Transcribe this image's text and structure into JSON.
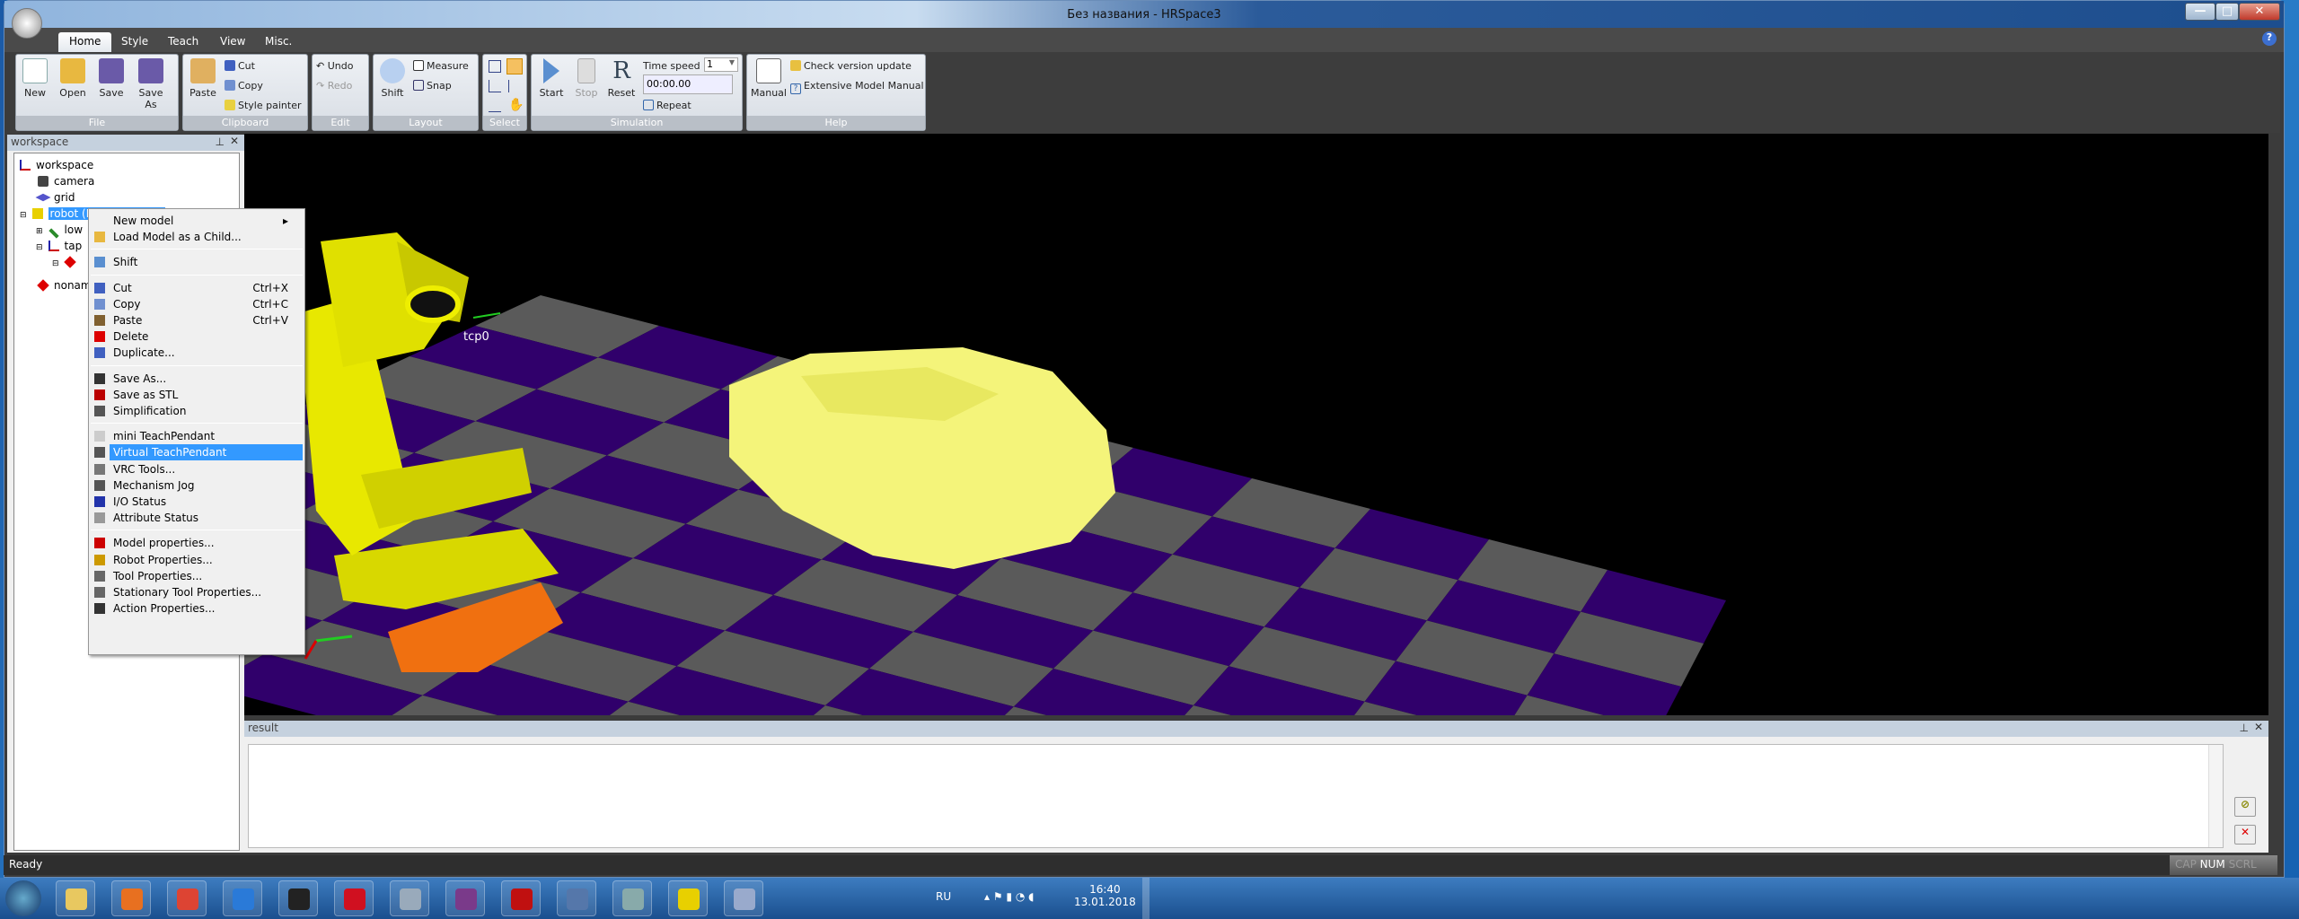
{
  "window": {
    "title": "Без названия - HRSpace3",
    "minimize": "—",
    "maximize": "□",
    "close": "✕"
  },
  "tabs": [
    "Home",
    "Style",
    "Teach",
    "View",
    "Misc."
  ],
  "ribbon": {
    "file": {
      "label": "File",
      "new": "New",
      "open": "Open",
      "save": "Save",
      "save_as": "Save As"
    },
    "clipboard": {
      "label": "Clipboard",
      "paste": "Paste",
      "cut": "Cut",
      "copy": "Copy",
      "style_painter": "Style painter"
    },
    "edit": {
      "label": "Edit",
      "undo": "Undo",
      "redo": "Redo"
    },
    "layout": {
      "label": "Layout",
      "shift": "Shift",
      "measure": "Measure",
      "snap": "Snap"
    },
    "select": {
      "label": "Select"
    },
    "simulation": {
      "label": "Simulation",
      "start": "Start",
      "stop": "Stop",
      "reset": "Reset",
      "time_speed_label": "Time speed",
      "time_speed_value": "1",
      "time": "00:00.00",
      "repeat": "Repeat"
    },
    "help": {
      "label": "Help",
      "manual": "Manual",
      "check_update": "Check version update",
      "model_manual": "Extensive Model Manual"
    }
  },
  "workspace": {
    "title": "workspace",
    "tree": [
      "workspace",
      "camera",
      "grid",
      "robot (MC165-02) [0]",
      "low",
      "tap",
      "",
      "nonam"
    ]
  },
  "viewport": {
    "tcp_label": "tcp0",
    "colors": {
      "floor_dark": "#30006b",
      "floor_light": "#5a5a5a",
      "robot": "#e8e800",
      "base": "#f07010",
      "car": "#f4f47a"
    }
  },
  "context_menu": {
    "items": [
      {
        "label": "New model",
        "submenu": true
      },
      {
        "label": "Load Model as a Child..."
      },
      {
        "label": "Shift"
      },
      {
        "label": "Cut",
        "shortcut": "Ctrl+X"
      },
      {
        "label": "Copy",
        "shortcut": "Ctrl+C"
      },
      {
        "label": "Paste",
        "shortcut": "Ctrl+V"
      },
      {
        "label": "Delete"
      },
      {
        "label": "Duplicate..."
      },
      {
        "label": "Save As..."
      },
      {
        "label": "Save as STL"
      },
      {
        "label": "Simplification"
      },
      {
        "label": "mini TeachPendant"
      },
      {
        "label": "Virtual TeachPendant",
        "highlighted": true
      },
      {
        "label": "VRC Tools..."
      },
      {
        "label": "Mechanism Jog"
      },
      {
        "label": "I/O Status"
      },
      {
        "label": "Attribute Status"
      },
      {
        "label": "Model properties..."
      },
      {
        "label": "Robot Properties..."
      },
      {
        "label": "Tool Properties..."
      },
      {
        "label": "Stationary Tool Properties..."
      },
      {
        "label": "Action Properties..."
      }
    ]
  },
  "result": {
    "title": "result"
  },
  "status": {
    "text": "Ready",
    "cap": "CAP",
    "num": "NUM",
    "scrl": "SCRL"
  },
  "taskbar": {
    "apps": [
      "explorer",
      "media-player",
      "chrome",
      "internet-explorer",
      "app-cursor",
      "opera",
      "notepad",
      "winrar",
      "acrobat",
      "autocad",
      "calculator",
      "hrspace",
      "paint"
    ],
    "lang": "RU",
    "time": "16:40",
    "date": "13.01.2018"
  }
}
